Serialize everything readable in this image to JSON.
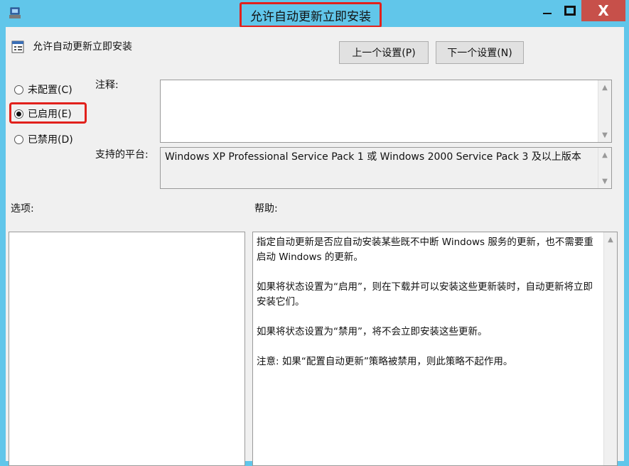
{
  "window": {
    "title": "允许自动更新立即安装",
    "minimize_glyph": "—",
    "close_glyph": "X"
  },
  "header": {
    "setting_name": "允许自动更新立即安装",
    "prev_button": "上一个设置(P)",
    "next_button": "下一个设置(N)"
  },
  "state": {
    "options": [
      {
        "label": "未配置(C)",
        "selected": false
      },
      {
        "label": "已启用(E)",
        "selected": true
      },
      {
        "label": "已禁用(D)",
        "selected": false
      }
    ]
  },
  "comment": {
    "label": "注释:",
    "value": ""
  },
  "platform": {
    "label": "支持的平台:",
    "value": "Windows XP Professional Service Pack 1 或 Windows 2000 Service Pack 3 及以上版本"
  },
  "options_panel": {
    "label": "选项:"
  },
  "help_panel": {
    "label": "帮助:",
    "paragraphs": [
      "指定自动更新是否应自动安装某些既不中断 Windows 服务的更新，也不需要重启动 Windows 的更新。",
      "如果将状态设置为“启用”，则在下载并可以安装这些更新装时，自动更新将立即安装它们。",
      "如果将状态设置为“禁用”，将不会立即安装这些更新。",
      "注意: 如果“配置自动更新”策略被禁用，则此策略不起作用。"
    ]
  },
  "colors": {
    "titlebar": "#61c6ea",
    "close_button": "#c7504a",
    "highlight": "#e1211c"
  }
}
